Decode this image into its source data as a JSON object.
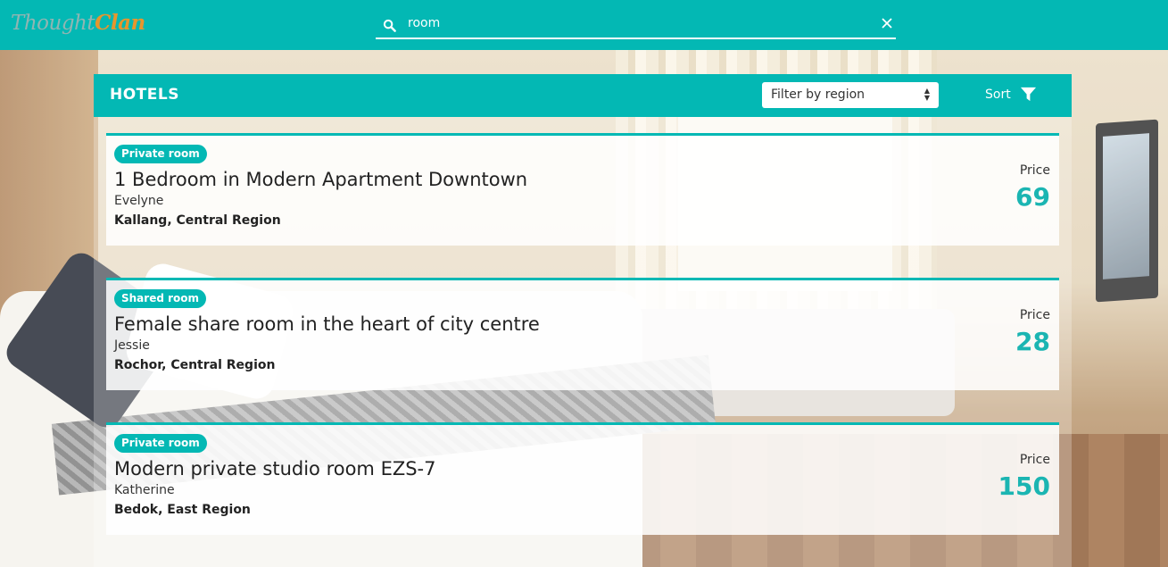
{
  "app": {
    "logo_part1": "Thought",
    "logo_part2": "Clan"
  },
  "search": {
    "value": "room",
    "icon": "search-icon",
    "clear_icon": "close-icon"
  },
  "panel": {
    "title": "HOTELS",
    "region_filter_selected": "Filter by region",
    "sort_label": "Sort",
    "sort_icon": "filter-icon"
  },
  "listings": [
    {
      "room_type": "Private room",
      "title": "1 Bedroom in Modern Apartment Downtown",
      "host": "Evelyne",
      "location": "Kallang, Central Region",
      "price_label": "Price",
      "price": "69"
    },
    {
      "room_type": "Shared room",
      "title": "Female share room in the heart of city centre",
      "host": "Jessie",
      "location": "Rochor, Central Region",
      "price_label": "Price",
      "price": "28"
    },
    {
      "room_type": "Private room",
      "title": "Modern private studio room EZS-7",
      "host": "Katherine",
      "location": "Bedok, East Region",
      "price_label": "Price",
      "price": "150"
    }
  ],
  "colors": {
    "accent": "#03b8b4",
    "price": "#1bb5b2",
    "logo_orange": "#e6962d"
  }
}
